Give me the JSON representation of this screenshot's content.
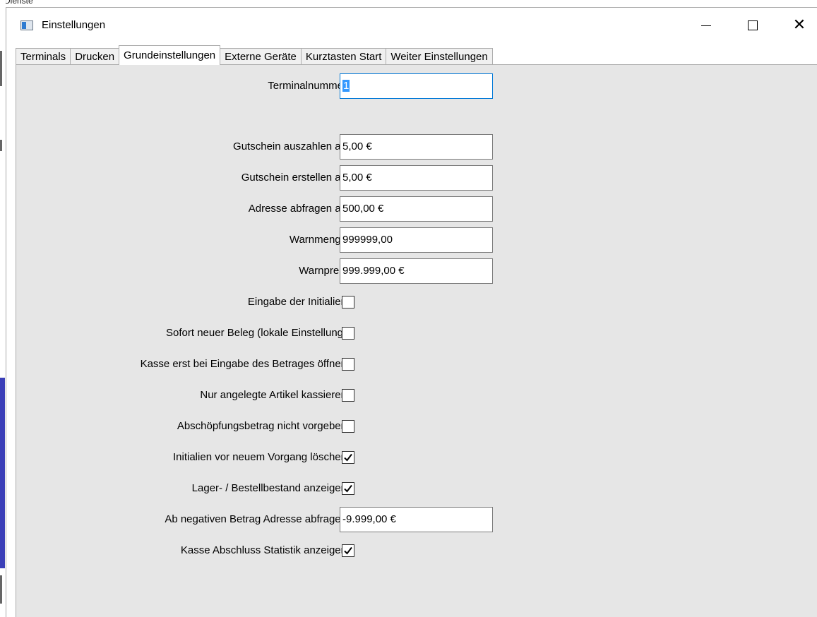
{
  "background": {
    "text": "Dienste"
  },
  "window": {
    "title": "Einstellungen",
    "controls": [
      "minimize",
      "maximize",
      "close"
    ]
  },
  "tabs": [
    {
      "label": "Terminals",
      "active": false
    },
    {
      "label": "Drucken",
      "active": false
    },
    {
      "label": "Grundeinstellungen",
      "active": true
    },
    {
      "label": "Externe Geräte",
      "active": false
    },
    {
      "label": "Kurztasten Start",
      "active": false
    },
    {
      "label": "Weiter Einstellungen",
      "active": false
    }
  ],
  "form": {
    "terminalnummer": {
      "label": "Terminalnummer",
      "value": "1"
    },
    "gutschein_auszahlen": {
      "label": "Gutschein auszahlen ab",
      "value": "5,00 €"
    },
    "gutschein_erstellen": {
      "label": "Gutschein erstellen ab",
      "value": "5,00 €"
    },
    "adresse_abfragen": {
      "label": "Adresse abfragen ab",
      "value": "500,00 €"
    },
    "warnmenge": {
      "label": "Warnmenge",
      "value": "999999,00"
    },
    "warnpreis": {
      "label": "Warnpreis",
      "value": "999.999,00 €"
    },
    "eingabe_initialien": {
      "label": "Eingabe der Initialien",
      "checked": false
    },
    "sofort_neuer_beleg": {
      "label": "Sofort neuer Beleg (lokale Einstellung)",
      "checked": false
    },
    "kasse_erst_bei_eingabe": {
      "label": "Kasse erst bei Eingabe des Betrages öffnen",
      "checked": false
    },
    "nur_angelegte_artikel": {
      "label": "Nur angelegte Artikel kassieren",
      "checked": false
    },
    "abschoepfungsbetrag": {
      "label": "Abschöpfungsbetrag nicht vorgeben",
      "checked": false
    },
    "initialien_loeschen": {
      "label": "Initialien vor neuem Vorgang löschen",
      "checked": true
    },
    "lagerbestand_anzeigen": {
      "label": "Lager- / Bestellbestand anzeigen",
      "checked": true
    },
    "negativer_betrag": {
      "label": "Ab negativen Betrag Adresse abfragen",
      "value": "-9.999,00 €"
    },
    "abschluss_statistik": {
      "label": "Kasse Abschluss Statistik anzeigen",
      "checked": true
    }
  }
}
